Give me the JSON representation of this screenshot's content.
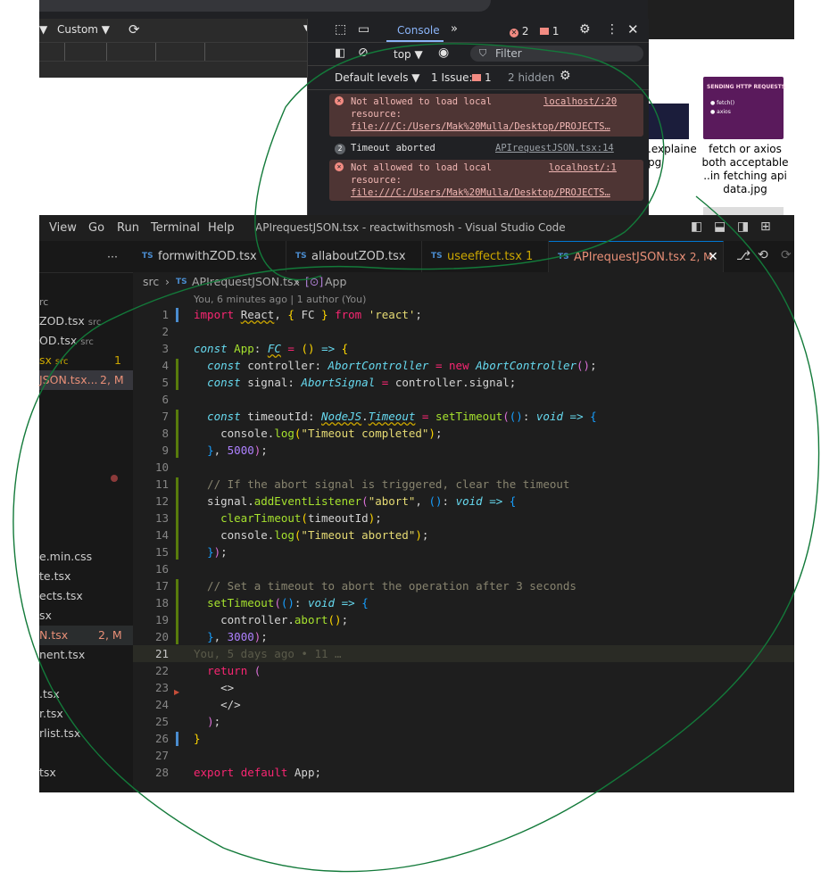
{
  "browser": {
    "custom_label": "Custom ▼"
  },
  "devtools": {
    "tab_console": "Console",
    "error_count": "2",
    "issue_count": "1",
    "context": "top ▼",
    "filter_placeholder": "Filter",
    "levels": "Default levels ▼",
    "issues_label": "1 Issue:",
    "issues_count": "1",
    "hidden": "2 hidden",
    "messages": [
      {
        "text1": "Not allowed to load local",
        "text2": "resource:",
        "text3": "file:///C:/Users/Mak%20Mulla/Desktop/PROJECTS…",
        "source": "localhost/:20"
      },
      {
        "count": "2",
        "text1": "Timeout aborted",
        "source": "APIrequestJSON.tsx:14"
      },
      {
        "text1": "Not allowed to load local",
        "text2": "resource:",
        "text3": "file:///C:/Users/Mak%20Mulla/Desktop/PROJECTS…",
        "source": "localhost/:1"
      }
    ]
  },
  "desktop": {
    "thumb_title": "SENDING HTTP REQUESTS",
    "thumb_bullet1": "fetch()",
    "thumb_bullet2": "axios",
    "file1_line1": ".explaine",
    "file1_line2": "pg",
    "file2_line1": "fetch or axios",
    "file2_line2": "both acceptable",
    "file2_line3": "..in fetching api",
    "file2_line4": "data.jpg"
  },
  "vscode": {
    "menu": [
      "View",
      "Go",
      "Run",
      "Terminal",
      "Help"
    ],
    "window_title": "APIrequestJSON.tsx - reactwithsmosh - Visual Studio Code",
    "more": "···",
    "tabs": [
      {
        "label": "formwithZOD.tsx"
      },
      {
        "label": "allaboutZOD.tsx"
      },
      {
        "label": "useeffect.tsx 1"
      },
      {
        "label": "APIrequestJSON.tsx",
        "badge": "2, M"
      }
    ],
    "tab_ts": "TS",
    "breadcrumb": {
      "src": "src",
      "file": "APIrequestJSON.tsx",
      "symbol": "App"
    },
    "blame": "You, 6 minutes ago | 1 author (You)",
    "inline_blame": "You, 5 days ago • 11 …",
    "sidebar": [
      {
        "text": "rc"
      },
      {
        "text": "ZOD.tsx",
        "sub": "src"
      },
      {
        "text": "OD.tsx",
        "sub": "src"
      },
      {
        "text": "sx",
        "sub": "src",
        "badge": "1"
      },
      {
        "text": "JSON.tsx...",
        "badge": "2, M"
      },
      {
        "text": "e.min.css"
      },
      {
        "text": "te.tsx"
      },
      {
        "text": "ects.tsx"
      },
      {
        "text": "sx"
      },
      {
        "text": "N.tsx",
        "badge": "2, M"
      },
      {
        "text": "nent.tsx"
      },
      {
        "text": ".tsx"
      },
      {
        "text": "r.tsx"
      },
      {
        "text": "rlist.tsx"
      },
      {
        "text": "tsx"
      }
    ],
    "line_numbers": [
      "1",
      "2",
      "3",
      "4",
      "5",
      "6",
      "7",
      "8",
      "9",
      "10",
      "11",
      "12",
      "13",
      "14",
      "15",
      "16",
      "17",
      "18",
      "19",
      "20",
      "21",
      "22",
      "23",
      "24",
      "25",
      "26",
      "27",
      "28"
    ]
  }
}
